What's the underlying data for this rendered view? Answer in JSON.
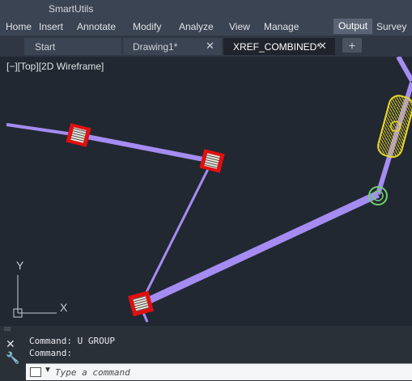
{
  "app": {
    "title": "SmartUtils"
  },
  "ribbon": {
    "tabs": [
      "Home",
      "Insert",
      "Annotate",
      "Modify",
      "Analyze",
      "View",
      "Manage",
      "Output",
      "Survey"
    ],
    "active": "Output"
  },
  "file_tabs": {
    "tabs": [
      "Start",
      "Drawing1*",
      "XREF_COMBINED*"
    ],
    "active": "XREF_COMBINED*",
    "add_symbol": "+",
    "close_symbol": "✕"
  },
  "viewport": {
    "label": "[−][Top][2D Wireframe]",
    "ucs_y": "Y",
    "ucs_x": "X"
  },
  "command": {
    "history": [
      "Command: U GROUP",
      "Command:"
    ],
    "placeholder": "Type a command"
  },
  "colors": {
    "line": "#a58cf2",
    "marker_red": "#e01010",
    "yellow": "#e8d62a",
    "green": "#6cd36c"
  }
}
